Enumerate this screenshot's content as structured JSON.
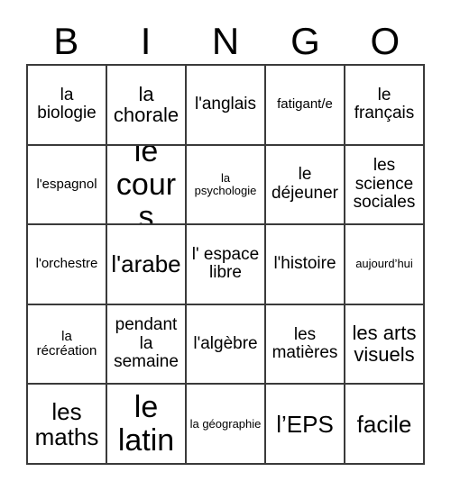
{
  "card": {
    "title": "BINGO",
    "header_letters": [
      "B",
      "I",
      "N",
      "G",
      "O"
    ],
    "columns": 5,
    "rows": 5,
    "border_color": "#3a3a3a",
    "background_color": "#ffffff",
    "text_color": "#000000",
    "cells": [
      {
        "text": "la biologie",
        "size": "md"
      },
      {
        "text": "la chorale",
        "size": "lg"
      },
      {
        "text": "l'anglais",
        "size": "md"
      },
      {
        "text": "fatigant/e",
        "size": "sm"
      },
      {
        "text": "le français",
        "size": "md"
      },
      {
        "text": "l'espagnol",
        "size": "sm"
      },
      {
        "text": "le cours",
        "size": "xxl"
      },
      {
        "text": "la psychologie",
        "size": "xs"
      },
      {
        "text": "le déjeuner",
        "size": "md"
      },
      {
        "text": "les science sociales",
        "size": "md"
      },
      {
        "text": "l'orchestre",
        "size": "sm"
      },
      {
        "text": "l'arabe",
        "size": "xl"
      },
      {
        "text": "l' espace libre",
        "size": "md"
      },
      {
        "text": "l'histoire",
        "size": "md"
      },
      {
        "text": "aujourd’hui",
        "size": "xs"
      },
      {
        "text": "la récréation",
        "size": "sm"
      },
      {
        "text": "pendant la semaine",
        "size": "md"
      },
      {
        "text": "l'algèbre",
        "size": "md"
      },
      {
        "text": "les matières",
        "size": "md"
      },
      {
        "text": "les arts visuels",
        "size": "lg"
      },
      {
        "text": "les maths",
        "size": "xl"
      },
      {
        "text": "le latin",
        "size": "xxl"
      },
      {
        "text": "la géographie",
        "size": "xs"
      },
      {
        "text": "l’EPS",
        "size": "xl"
      },
      {
        "text": "facile",
        "size": "xl"
      }
    ]
  }
}
